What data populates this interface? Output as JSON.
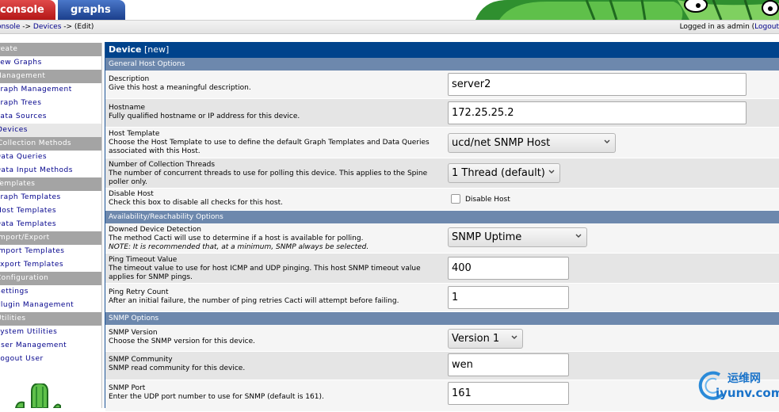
{
  "tabs": {
    "console": "console",
    "graphs": "graphs"
  },
  "breadcrumb": {
    "part1": "console",
    "sep1": " -> ",
    "part2": "Devices",
    "sep2": " -> ",
    "part3": "(Edit)"
  },
  "login": {
    "prefix": "Logged in as admin (",
    "logout": "Logout"
  },
  "sidebar": {
    "create_head": "Create",
    "new_graphs": "New Graphs",
    "management_head": "Management",
    "graph_management": "Graph Management",
    "graph_trees": "Graph Trees",
    "data_sources": "Data Sources",
    "devices": "Devices",
    "collection_methods_head": "Collection Methods",
    "data_queries": "Data Queries",
    "data_input_methods": "Data Input Methods",
    "templates_head": "Templates",
    "graph_templates": "Graph Templates",
    "host_templates": "Host Templates",
    "data_templates": "Data Templates",
    "import_export_head": "Import/Export",
    "import_templates": "Import Templates",
    "export_templates": "Export Templates",
    "configuration_head": "Configuration",
    "settings": "Settings",
    "plugin_management": "Plugin Management",
    "utilities_head": "Utilities",
    "system_utilities": "System Utilities",
    "user_management": "User Management",
    "logout_user": "Logout User"
  },
  "form": {
    "title": "Device",
    "title_suffix": " [new]",
    "general_head": "General Host Options",
    "description": {
      "label": "Description",
      "help": "Give this host a meaningful description.",
      "value": "server2"
    },
    "hostname": {
      "label": "Hostname",
      "help": "Fully qualified hostname or IP address for this device.",
      "value": "172.25.25.2"
    },
    "host_template": {
      "label": "Host Template",
      "help": "Choose the Host Template to use to define the default Graph Templates and Data Queries associated with this Host.",
      "value": "ucd/net SNMP Host"
    },
    "threads": {
      "label": "Number of Collection Threads",
      "help": "The number of concurrent threads to use for polling this device. This applies to the Spine poller only.",
      "value": "1 Thread (default)"
    },
    "disable_host": {
      "label": "Disable Host",
      "help": "Check this box to disable all checks for this host.",
      "checkbox_label": "Disable Host"
    },
    "availability_head": "Availability/Reachability Options",
    "downed_detection": {
      "label": "Downed Device Detection",
      "help": "The method Cacti will use to determine if a host is available for polling.",
      "note": "NOTE: It is recommended that, at a minimum, SNMP always be selected.",
      "value": "SNMP Uptime"
    },
    "ping_timeout": {
      "label": "Ping Timeout Value",
      "help": "The timeout value to use for host ICMP and UDP pinging. This host SNMP timeout value applies for SNMP pings.",
      "value": "400"
    },
    "ping_retry": {
      "label": "Ping Retry Count",
      "help": "After an initial failure, the number of ping retries Cacti will attempt before failing.",
      "value": "1"
    },
    "snmp_head": "SNMP Options",
    "snmp_version": {
      "label": "SNMP Version",
      "help": "Choose the SNMP version for this device.",
      "value": "Version 1"
    },
    "snmp_community": {
      "label": "SNMP Community",
      "help": "SNMP read community for this device.",
      "value": "wen"
    },
    "snmp_port": {
      "label": "SNMP Port",
      "help": "Enter the UDP port number to use for SNMP (default is 161).",
      "value": "161"
    }
  },
  "watermark": {
    "cn": "运维网",
    "url": "iyunv.com"
  },
  "colors": {
    "header_blue": "#00438c",
    "section_blue": "#6d88ad",
    "link": "#00008b",
    "sidebar_head": "#a4a4a4"
  }
}
